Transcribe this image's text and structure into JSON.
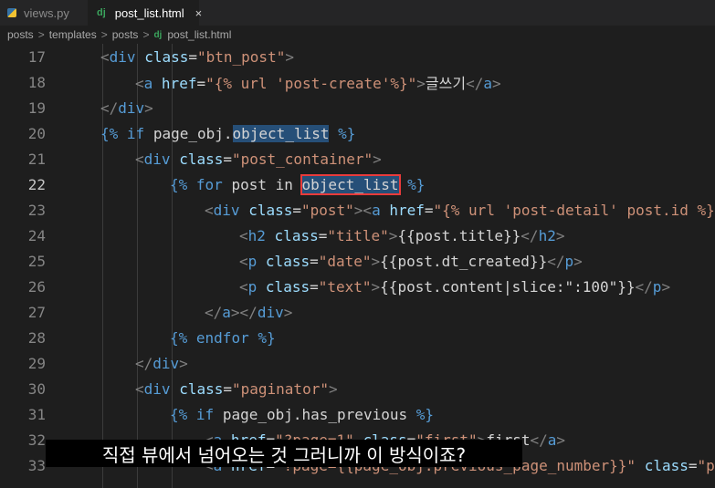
{
  "tabs": [
    {
      "label": "views.py",
      "icon": "python-file-icon"
    },
    {
      "label": "post_list.html",
      "icon": "django-file-icon",
      "close": "×"
    }
  ],
  "breadcrumb": [
    "posts",
    "templates",
    "posts",
    "post_list.html"
  ],
  "breadcrumb_sep": ">",
  "dj_label": "dj",
  "lines": [
    {
      "n": "17"
    },
    {
      "n": "18"
    },
    {
      "n": "19"
    },
    {
      "n": "20"
    },
    {
      "n": "21"
    },
    {
      "n": "22"
    },
    {
      "n": "23"
    },
    {
      "n": "24"
    },
    {
      "n": "25"
    },
    {
      "n": "26"
    },
    {
      "n": "27"
    },
    {
      "n": "28"
    },
    {
      "n": "29"
    },
    {
      "n": "30"
    },
    {
      "n": "31"
    },
    {
      "n": "32"
    },
    {
      "n": "33"
    }
  ],
  "code": {
    "l17": {
      "tag": "div",
      "attr": "class",
      "val": "\"btn_post\""
    },
    "l18": {
      "tag": "a",
      "attr": "href",
      "val": "\"{% url 'post-create'%}\"",
      "text": "글쓰기",
      "close": "a"
    },
    "l19": {
      "close": "div"
    },
    "l20": {
      "open": "{%",
      "kw": "if",
      "expr1": "page_obj.",
      "expr2": "object_list",
      "end": "%}"
    },
    "l21": {
      "tag": "div",
      "attr": "class",
      "val": "\"post_container\""
    },
    "l22": {
      "open": "{%",
      "kw": "for",
      "expr1": "post",
      "kw2": "in",
      "boxed": "object_list",
      "end": "%}"
    },
    "l23": {
      "tag": "div",
      "attr": "class",
      "val": "\"post\"",
      "tag2": "a",
      "attr2": "href",
      "val2": "\"{% url 'post-detail' post.id %}\""
    },
    "l24": {
      "tag": "h2",
      "attr": "class",
      "val": "\"title\"",
      "text": "{{post.title}}",
      "close": "h2"
    },
    "l25": {
      "tag": "p",
      "attr": "class",
      "val": "\"date\"",
      "text": "{{post.dt_created}}",
      "close": "p"
    },
    "l26": {
      "tag": "p",
      "attr": "class",
      "val": "\"text\"",
      "text": "{{post.content|slice:\":100\"}}",
      "close": "p"
    },
    "l27": {
      "close1": "a",
      "close2": "div"
    },
    "l28": {
      "open": "{%",
      "kw": "endfor",
      "end": "%}"
    },
    "l29": {
      "close": "div"
    },
    "l30": {
      "tag": "div",
      "attr": "class",
      "val": "\"paginator\""
    },
    "l31": {
      "open": "{%",
      "kw": "if",
      "expr1": "page_obj.has_previous",
      "end": "%}"
    },
    "l32": {
      "tag": "a",
      "attr": "href",
      "val": "\"?page=1\"",
      "attr2": "class",
      "val2": "\"first\"",
      "text": "first",
      "close": "a"
    },
    "l33": {
      "tag": "a",
      "attr": "href",
      "val": "\"?page={{page_obj.previous_page_number}}\"",
      "attr2": "class",
      "val2": "\"pr"
    }
  },
  "subtitle": "직접 뷰에서 넘어오는 것 그러니까 이 방식이죠?"
}
